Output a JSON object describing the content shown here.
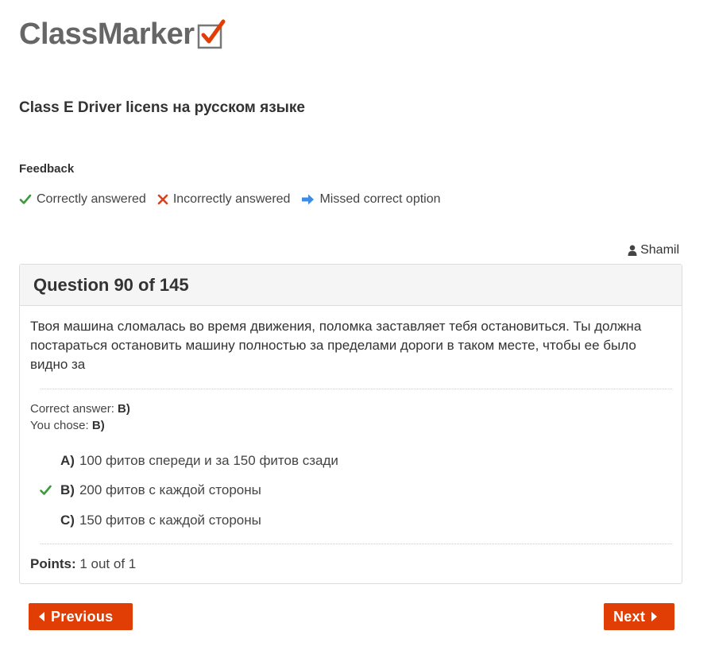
{
  "brand": {
    "name": "ClassMarker"
  },
  "quiz": {
    "title": "Class E Driver licens на русском языке"
  },
  "feedback": {
    "title": "Feedback",
    "legend": {
      "correct": "Correctly answered",
      "incorrect": "Incorrectly answered",
      "missed": "Missed correct option"
    }
  },
  "user": {
    "name": "Shamil"
  },
  "question": {
    "header": "Question 90 of 145",
    "text": "Твоя машина сломалась во время движения, поломка заставляет тебя остановиться. Ты должна постараться остановить машину полностью за пределами дороги в таком месте, чтобы ее было видно за",
    "correct_label": "Correct answer:",
    "correct_value": "B)",
    "chosen_label": "You chose:",
    "chosen_value": "B)",
    "options": [
      {
        "letter": "A)",
        "text": "100 фитов спереди и за 150 фитов сзади",
        "mark": ""
      },
      {
        "letter": "B)",
        "text": "200 фитов с каждой стороны",
        "mark": "correct"
      },
      {
        "letter": "C)",
        "text": "150 фитов с каждой стороны",
        "mark": ""
      }
    ],
    "points_label": "Points:",
    "points_value": "1 out of 1"
  },
  "nav": {
    "previous_label": "Previous",
    "next_label": "Next"
  },
  "colors": {
    "accent": "#e03e05",
    "correct": "#3c9a3c",
    "incorrect": "#d9431c",
    "missed": "#3d8ce8"
  }
}
